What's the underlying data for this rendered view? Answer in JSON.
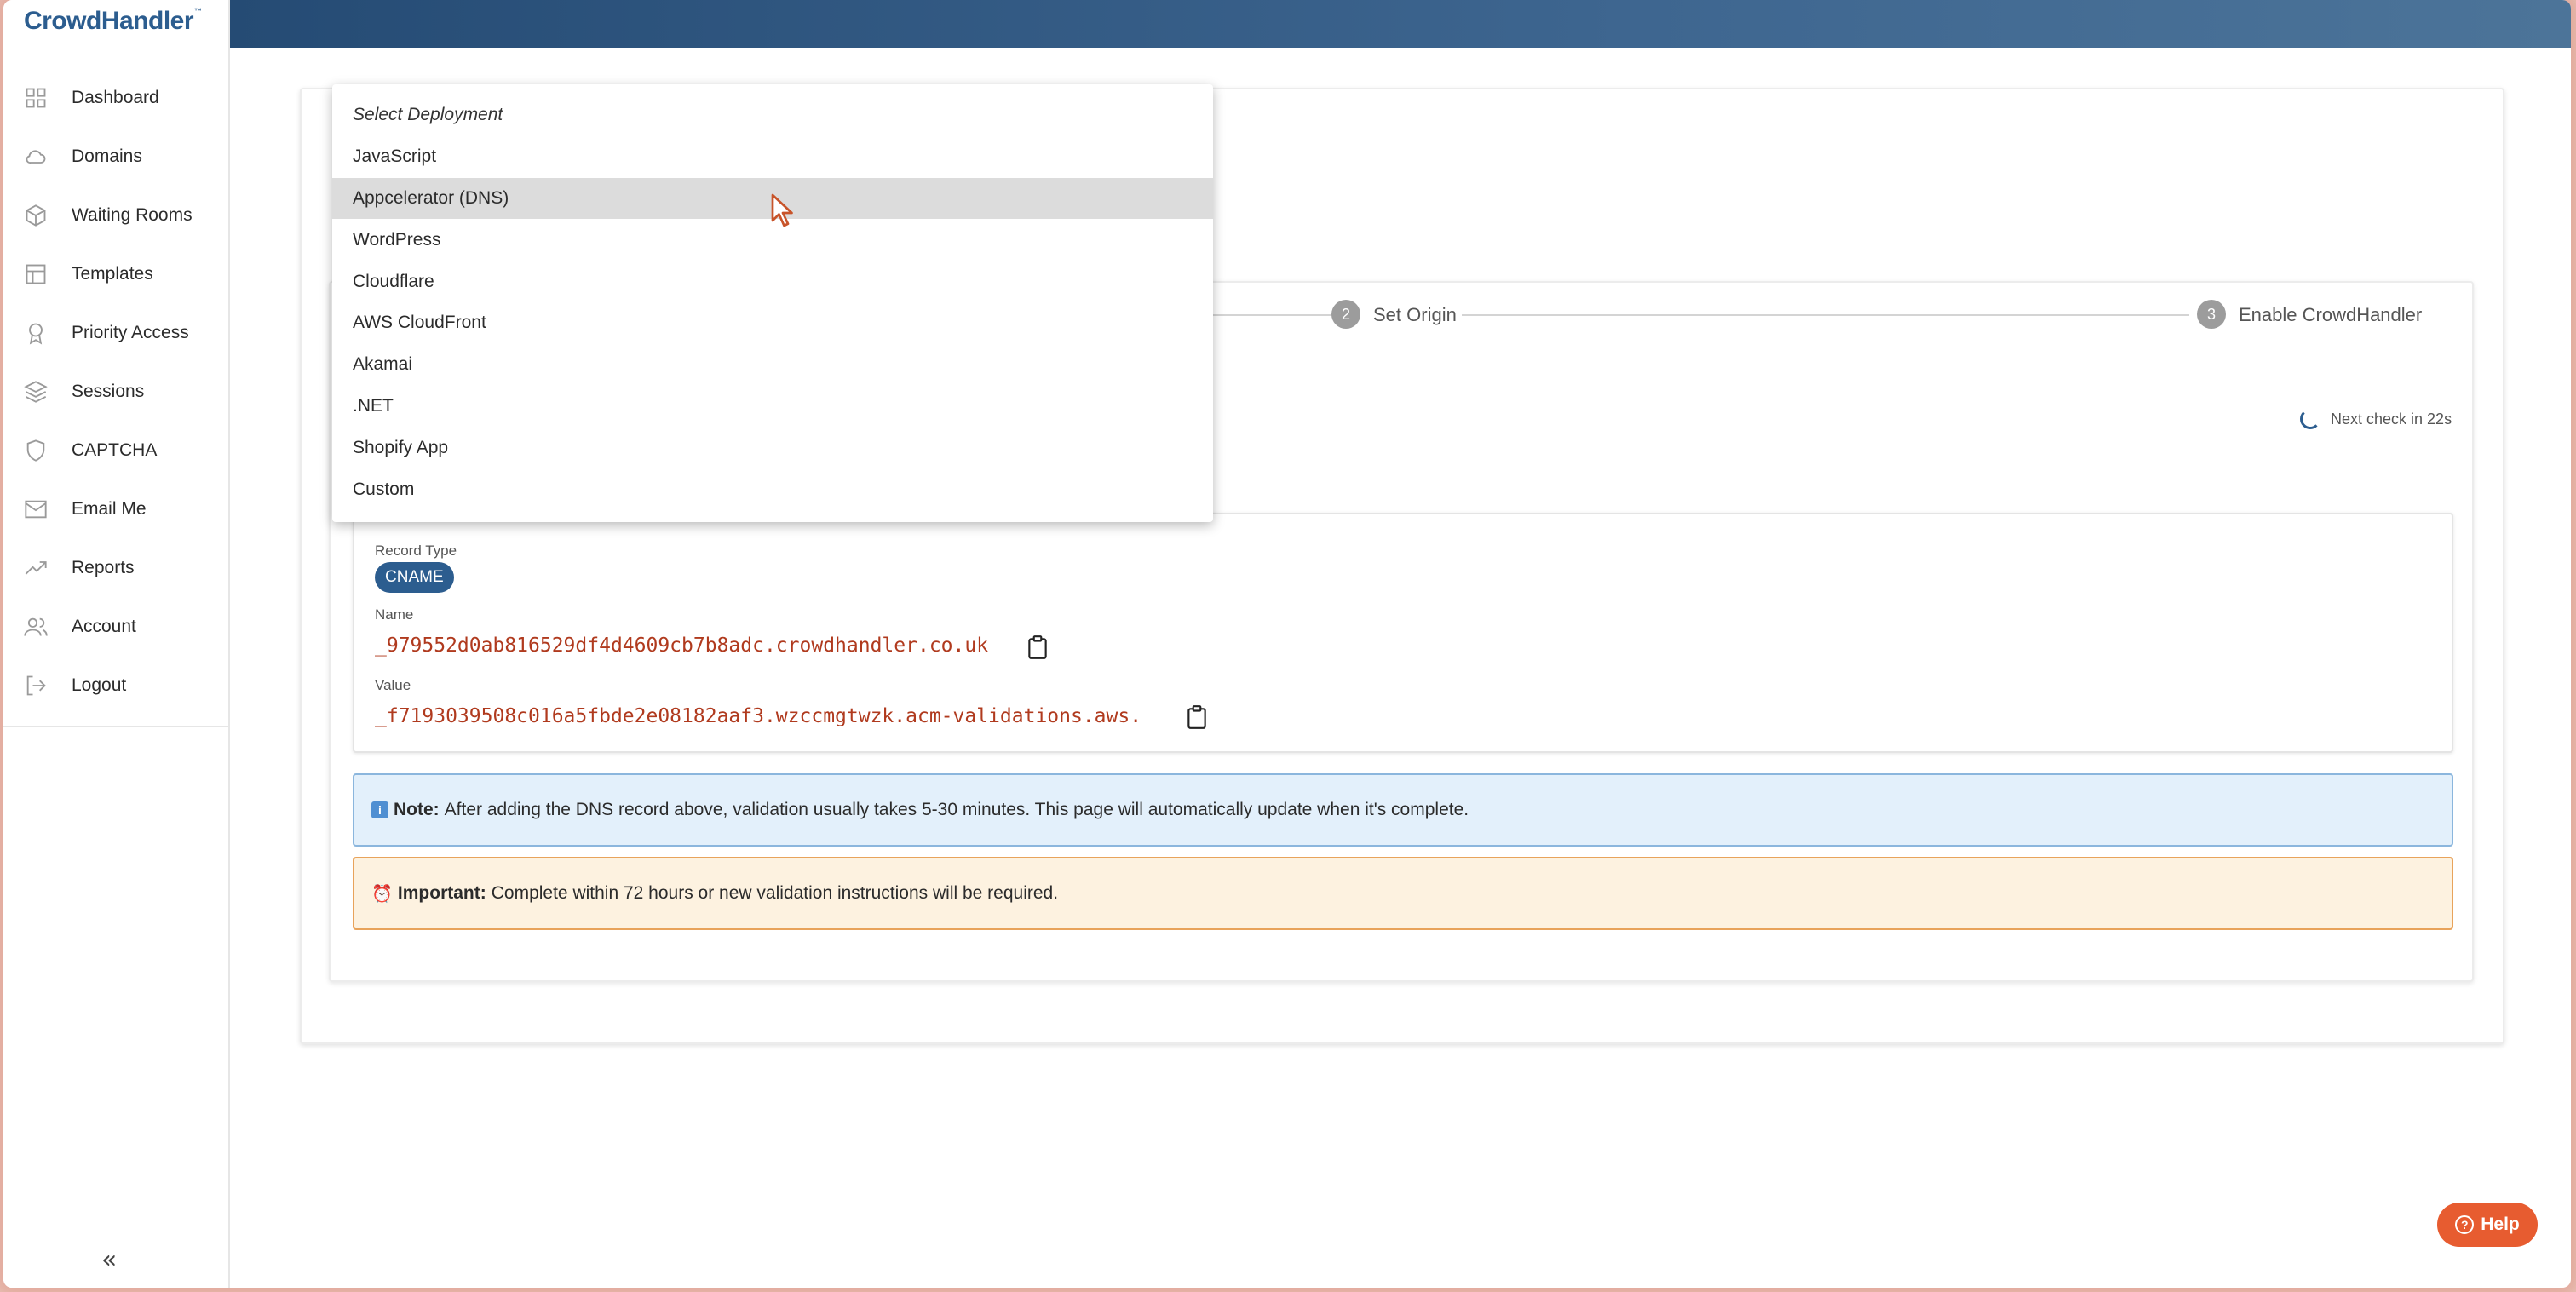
{
  "app": {
    "logo": "CrowdHandler",
    "trademark": "™"
  },
  "sidebar": {
    "items": [
      {
        "label": "Dashboard",
        "icon": "grid-icon"
      },
      {
        "label": "Domains",
        "icon": "cloud-icon"
      },
      {
        "label": "Waiting Rooms",
        "icon": "cube-icon"
      },
      {
        "label": "Templates",
        "icon": "layout-icon"
      },
      {
        "label": "Priority Access",
        "icon": "award-icon"
      },
      {
        "label": "Sessions",
        "icon": "layers-icon"
      },
      {
        "label": "CAPTCHA",
        "icon": "shield-icon"
      },
      {
        "label": "Email Me",
        "icon": "mail-icon"
      },
      {
        "label": "Reports",
        "icon": "trending-icon"
      },
      {
        "label": "Account",
        "icon": "users-icon"
      },
      {
        "label": "Logout",
        "icon": "logout-icon"
      }
    ],
    "collapse_label": "«"
  },
  "stepper": {
    "steps": [
      {
        "number": "2",
        "label": "Set Origin"
      },
      {
        "number": "3",
        "label": "Enable CrowdHandler"
      }
    ]
  },
  "status": {
    "next_check": "Next check in 22s"
  },
  "dns_record": {
    "record_type_label": "Record Type",
    "record_type": "CNAME",
    "name_label": "Name",
    "name_value": "_979552d0ab816529df4d4609cb7b8adc.crowdhandler.co.uk",
    "value_label": "Value",
    "value_value": "_f7193039508c016a5fbde2e08182aaf3.wzccmgtwzk.acm-validations.aws."
  },
  "note": {
    "icon": "info-icon",
    "prefix": "Note:",
    "text": "After adding the DNS record above, validation usually takes 5-30 minutes. This page will automatically update when it's complete."
  },
  "important": {
    "icon": "alarm-clock-icon",
    "prefix": "Important:",
    "text": "Complete within 72 hours or new validation instructions will be required."
  },
  "deployment_dropdown": {
    "header": "Select Deployment",
    "options": [
      "JavaScript",
      "Appcelerator (DNS)",
      "WordPress",
      "Cloudflare",
      "AWS CloudFront",
      "Akamai",
      ".NET",
      "Shopify App",
      "Custom"
    ],
    "highlighted": "Appcelerator (DNS)"
  },
  "help": {
    "label": "Help"
  },
  "colors": {
    "brand": "#2c5d8f",
    "accent_orange": "#e75c30",
    "code_red": "#b03a1e",
    "note_bg": "#e3f0fb",
    "important_bg": "#fdf2e0"
  }
}
